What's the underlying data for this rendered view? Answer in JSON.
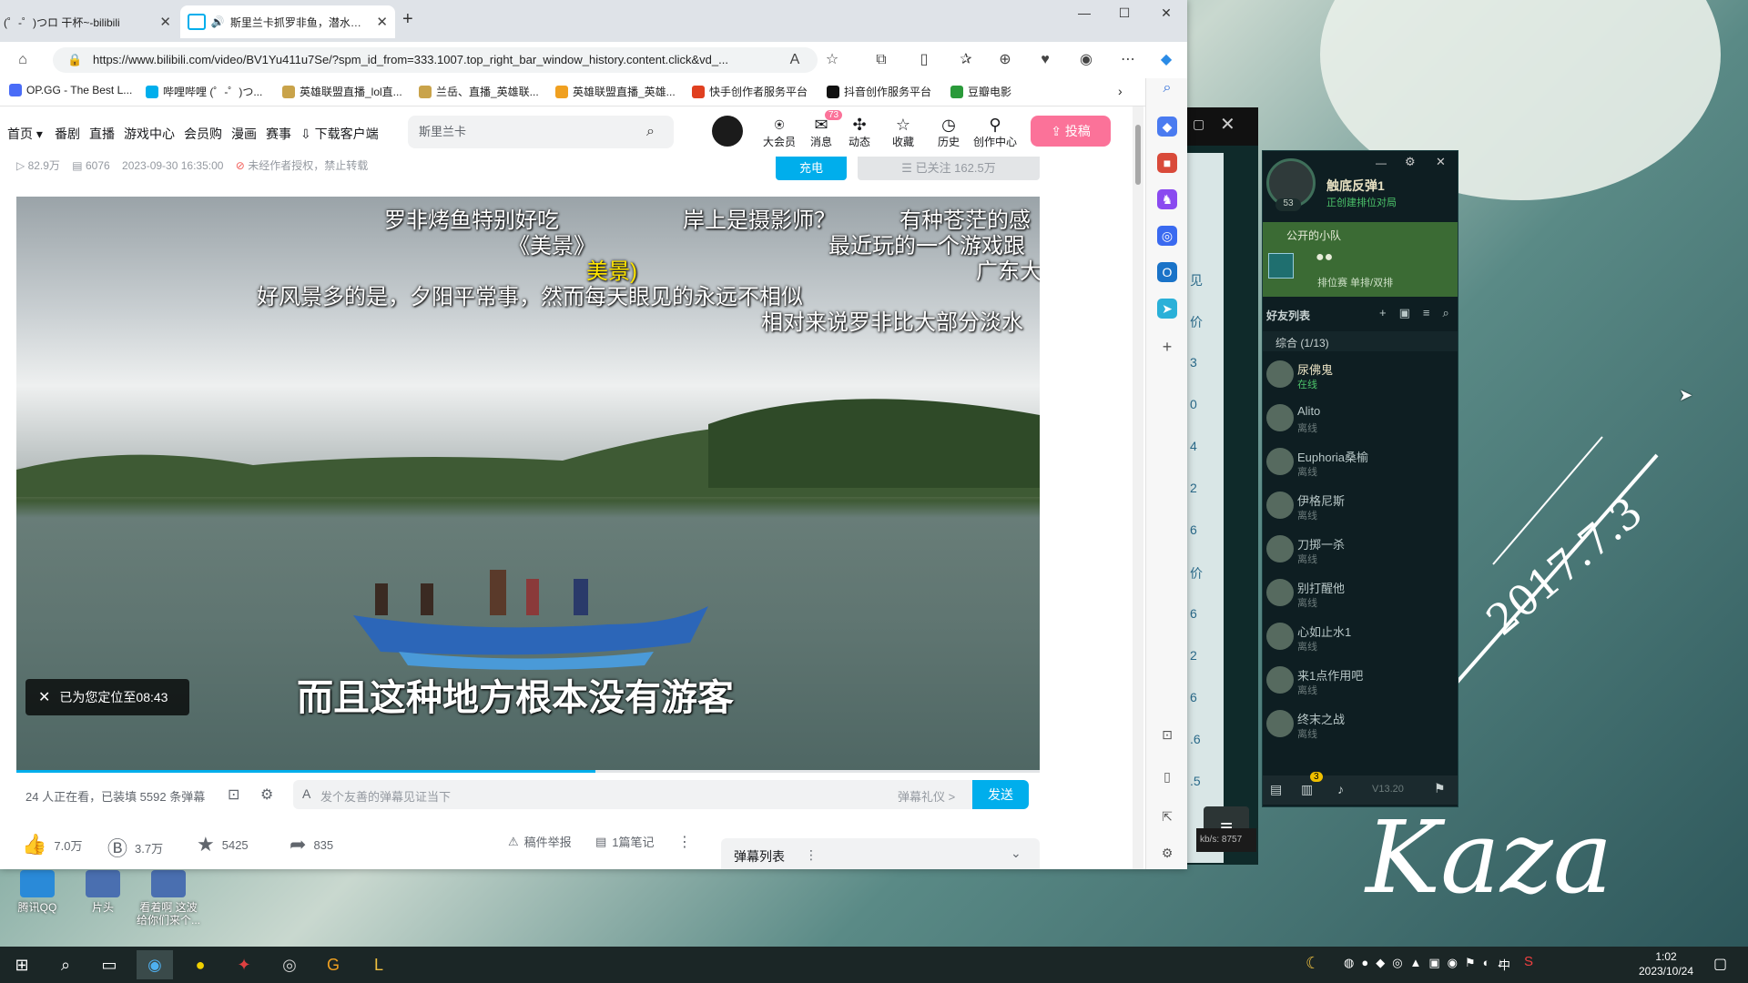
{
  "browser": {
    "tabs": [
      {
        "title": "(゜-゜)つロ 干杯~-bilibili",
        "active": false
      },
      {
        "title": "斯里兰卡抓罗非鱼，潜水摸...",
        "active": true
      }
    ],
    "new_tab": "+",
    "url": "https://www.bilibili.com/video/BV1Yu411u7Se/?spm_id_from=333.1007.top_right_bar_window_history.content.click&vd_...",
    "bookmarks": [
      "OP.GG - The Best L...",
      "哔哩哔哩 (゜-゜)つ...",
      "英雄联盟直播_lol直...",
      "兰岳、直播_英雄联...",
      "英雄联盟直播_英雄...",
      "快手创作者服务平台",
      "抖音创作服务平台",
      "豆瓣电影"
    ]
  },
  "bili": {
    "nav": [
      "首页",
      "番剧",
      "直播",
      "游戏中心",
      "会员购",
      "漫画",
      "赛事",
      "下载客户端"
    ],
    "search_placeholder": "斯里兰卡",
    "header_icons": [
      {
        "label": "大会员",
        "icon": "vip-icon"
      },
      {
        "label": "消息",
        "icon": "message-icon",
        "badge": "73"
      },
      {
        "label": "动态",
        "icon": "dynamic-icon"
      },
      {
        "label": "收藏",
        "icon": "favorite-icon"
      },
      {
        "label": "历史",
        "icon": "history-icon"
      },
      {
        "label": "创作中心",
        "icon": "creator-icon"
      }
    ],
    "upload_label": "投稿",
    "meta": {
      "views": "82.9万",
      "danmaku": "6076",
      "date": "2023-09-30 16:35:00",
      "copyright": "未经作者授权，禁止转载"
    },
    "charge_label": "充电",
    "follow_label": "已关注 162.5万",
    "danmaku_overlay": [
      "罗非烤鱼特别好吃",
      "岸上是摄影师？",
      "有种苍茫的感",
      "《美景》",
      "最近玩的一个游戏跟",
      "美景)",
      "广东大",
      "好风景多的是，夕阳平常事，然而每天眼见的永远不相似",
      "相对来说罗非比大部分淡水"
    ],
    "subtitle": "而且这种地方根本没有游客",
    "toast": "已为您定位至08:43",
    "watching": "24 人正在看，已装填 5592 条弹幕",
    "danmaku_placeholder": "发个友善的弹幕见证当下",
    "danmaku_etiquette": "弹幕礼仪 >",
    "send_label": "发送",
    "actions": {
      "like": "7.0万",
      "coin": "3.7万",
      "fav": "5425",
      "share": "835",
      "report": "稿件举报",
      "notes": "1篇笔记"
    },
    "danmaku_list": "弹幕列表",
    "side_numbers": [
      "见",
      "价",
      "3",
      "0",
      "4",
      "2",
      "6",
      "价",
      "6",
      "2",
      "6",
      ".6",
      ".5"
    ]
  },
  "qq": {
    "profile_name": "触底反弹1",
    "profile_status": "正创建排位对局",
    "level": "53",
    "team_label": "公开的小队",
    "queue_label": "排位赛 单排/双排",
    "friends_title": "好友列表",
    "group_label": "综合 (1/13)",
    "friends": [
      {
        "name": "尿佛鬼",
        "status": "在线"
      },
      {
        "name": "Alito",
        "status": "离线"
      },
      {
        "name": "Euphoria桑榆",
        "status": "离线"
      },
      {
        "name": "伊格尼斯",
        "status": "离线"
      },
      {
        "name": "刀掷一杀",
        "status": "离线"
      },
      {
        "name": "别打醒他",
        "status": "离线"
      },
      {
        "name": "心如止水1",
        "status": "离线"
      },
      {
        "name": "来1点作用吧",
        "status": "离线"
      },
      {
        "name": "终末之战",
        "status": "离线"
      }
    ],
    "version": "V13.20",
    "chat_badge": "3",
    "speed": "kb/s: 8757"
  },
  "desktop": {
    "icons": [
      "腾讯QQ",
      "片头",
      "看着啊 这波给你们来个..."
    ],
    "signature_1": "2017.7.3",
    "signature_2": "Kaza"
  },
  "taskbar": {
    "time": "1:02",
    "date": "2023/10/24",
    "ime": "中"
  },
  "colors": {
    "bili_pink": "#fb7299",
    "bili_blue": "#00aeec",
    "qq_green": "#3a6e3a"
  }
}
